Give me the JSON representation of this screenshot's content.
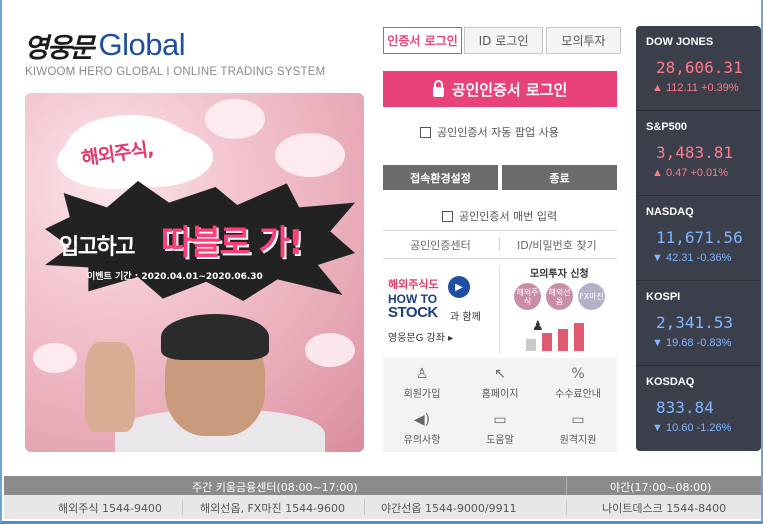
{
  "brand": {
    "name_kr": "영웅문",
    "name_en": "Global",
    "subtitle": "KIWOOM HERO GLOBAL  I  ONLINE TRADING SYSTEM"
  },
  "banner": {
    "bubble": "해외주식,",
    "slogan_a": "입고하고",
    "slogan_b": "따블로 가!",
    "event_period": "이벤트 기간 : 2020.04.01~2020.06.30"
  },
  "login": {
    "tabs": [
      "인증서 로그인",
      "ID 로그인",
      "모의투자"
    ],
    "active_tab": 0,
    "cert_button": "공인인증서 로그인",
    "auto_popup": "공인인증서 자동 팝업 사용",
    "settings_button": "접속환경설정",
    "exit_button": "종료",
    "manual_input": "공인인증서 매번 입력",
    "cert_center": "공인인증센터",
    "find_id_pw": "ID/비밀번호 찾기"
  },
  "promo": {
    "left_title": "해외주식도",
    "left_logo_a": "HOW TO",
    "left_logo_b": "STOCK",
    "left_with": "과 함께",
    "left_link": "영웅문G 강좌 ▸",
    "right_title": "모의투자 신청",
    "badges": [
      "해외주식",
      "해외선옵",
      "FX마진"
    ]
  },
  "quick_menu": [
    {
      "icon": "person-icon",
      "glyph": "♙",
      "label": "회원가입"
    },
    {
      "icon": "cursor-icon",
      "glyph": "↖",
      "label": "홈페이지"
    },
    {
      "icon": "percent-doc-icon",
      "glyph": "%",
      "label": "수수료안내"
    },
    {
      "icon": "speaker-icon",
      "glyph": "◀)",
      "label": "유의사항"
    },
    {
      "icon": "chat-icon",
      "glyph": "▭",
      "label": "도움말"
    },
    {
      "icon": "monitor-icon",
      "glyph": "▭",
      "label": "원격지원"
    }
  ],
  "market": [
    {
      "name": "DOW JONES",
      "value": "28,606.31",
      "arrow": "▲",
      "change": "112.11",
      "pct": "+0.39%",
      "dir": "up"
    },
    {
      "name": "S&P500",
      "value": "3,483.81",
      "arrow": "▲",
      "change": "0.47",
      "pct": "+0.01%",
      "dir": "up"
    },
    {
      "name": "NASDAQ",
      "value": "11,671.56",
      "arrow": "▼",
      "change": "42.31",
      "pct": "-0.36%",
      "dir": "down"
    },
    {
      "name": "KOSPI",
      "value": "2,341.53",
      "arrow": "▼",
      "change": "19.68",
      "pct": "-0.83%",
      "dir": "down"
    },
    {
      "name": "KOSDAQ",
      "value": "833.84",
      "arrow": "▼",
      "change": "10.60",
      "pct": "-1.26%",
      "dir": "down"
    }
  ],
  "footer": {
    "day_label": "주간  키움금융센터(08:00~17:00)",
    "night_label": "야간(17:00~08:00)",
    "contacts": [
      "해외주식 1544-9400",
      "해외선옵, FX마진 1544-9600",
      "야간선옵 1544-9000/9911",
      "나이트데스크 1544-8400"
    ]
  },
  "colors": {
    "accent": "#e9417a",
    "brand_blue": "#1e4fa3",
    "panel": "#3b3f4b",
    "up": "#ff7a8a",
    "down": "#7fb6ff"
  }
}
